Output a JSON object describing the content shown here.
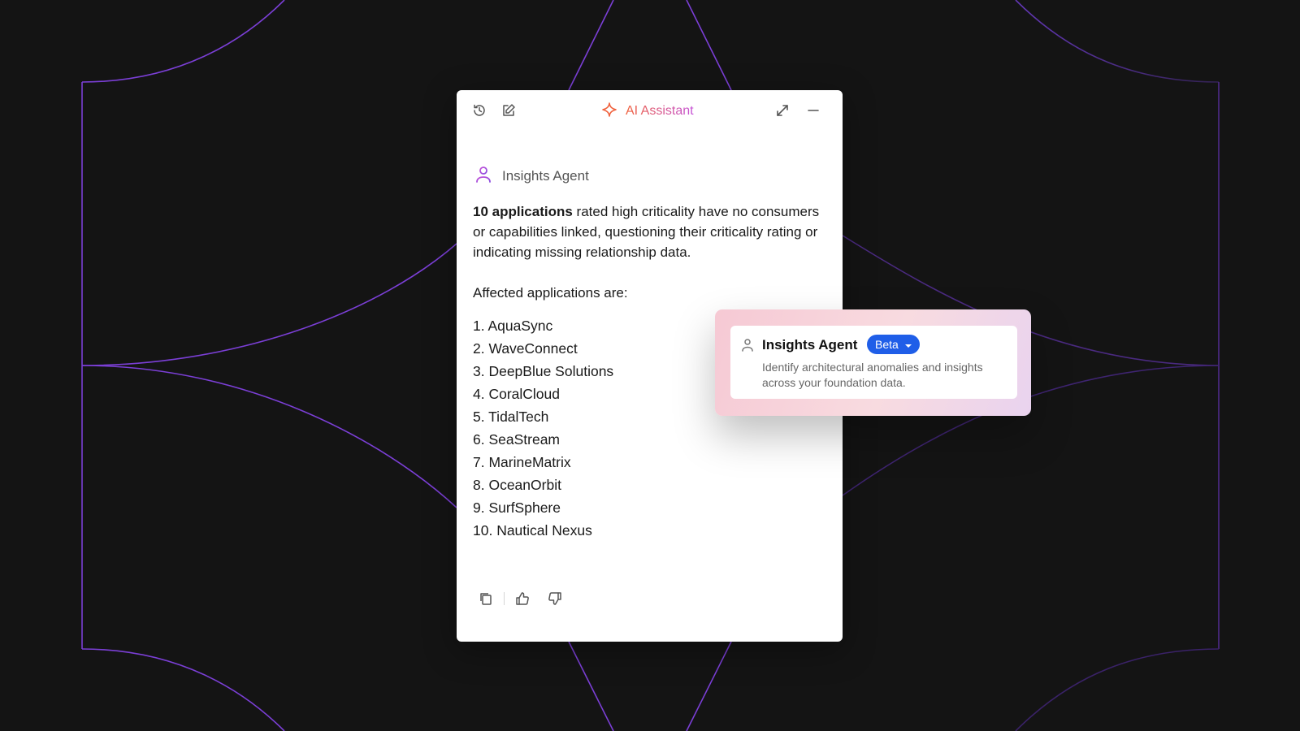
{
  "assistant": {
    "title": "AI Assistant",
    "agent_name": "Insights Agent",
    "message": {
      "highlight": "10 applications",
      "body": " rated high criticality have no consumers or capabilities linked, questioning their criticality rating or indicating missing relationship data.",
      "list_intro": "Affected applications are:",
      "applications": [
        "1. AquaSync",
        "2. WaveConnect",
        "3. DeepBlue Solutions",
        "4. CoralCloud",
        "5. TidalTech",
        "6. SeaStream",
        "7. MarineMatrix",
        "8. OceanOrbit",
        "9. SurfSphere",
        "10. Nautical Nexus"
      ]
    },
    "header_icons": [
      "history-icon",
      "edit-icon",
      "sparkle-icon",
      "expand-icon",
      "minimize-icon"
    ],
    "action_icons": [
      "copy-icon",
      "thumbs-up-icon",
      "thumbs-down-icon"
    ]
  },
  "agent_popup": {
    "title": "Insights Agent",
    "badge": "Beta",
    "description": "Identify architectural anomalies and insights across your foundation data."
  },
  "colors": {
    "background": "#141414",
    "accent_purple": "#7b3fd6",
    "title_gradient_start": "#f0613c",
    "title_gradient_end": "#c452d8",
    "badge_blue": "#1f5ee8"
  }
}
